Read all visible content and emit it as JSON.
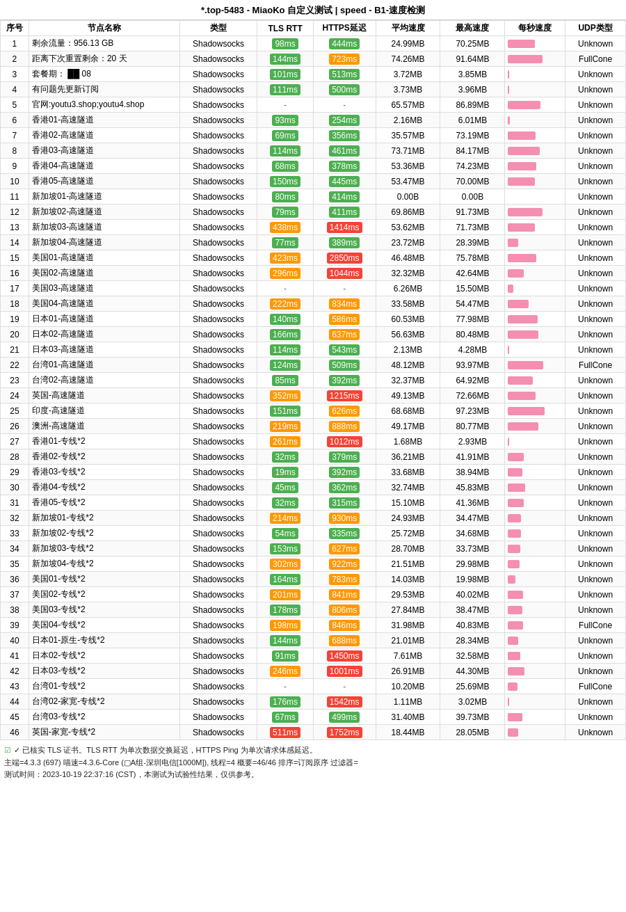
{
  "title": "*.top-5483 - MiaoKo 自定义测试 | speed - B1-速度检测",
  "columns": [
    "序号",
    "节点名称",
    "类型",
    "TLS RTT",
    "HTTPS延迟",
    "平均速度",
    "最高速度",
    "每秒速度",
    "UDP类型"
  ],
  "rows": [
    {
      "no": 1,
      "name": "剩余流量：956.13 GB",
      "type": "Shadowsocks",
      "tls": "98ms",
      "tlsClass": "tls-green",
      "https": "444ms",
      "httpsClass": "https-green",
      "avg": "24.99MB",
      "max": "70.25MB",
      "barW": 70,
      "udp": "Unknown"
    },
    {
      "no": 2,
      "name": "距离下次重置剩余：20 天",
      "type": "Shadowsocks",
      "tls": "144ms",
      "tlsClass": "tls-green",
      "https": "723ms",
      "httpsClass": "https-orange",
      "avg": "74.26MB",
      "max": "91.64MB",
      "barW": 90,
      "udp": "FullCone"
    },
    {
      "no": 3,
      "name": "套餐期：  ██  08",
      "type": "Shadowsocks",
      "tls": "101ms",
      "tlsClass": "tls-green",
      "https": "513ms",
      "httpsClass": "https-green",
      "avg": "3.72MB",
      "max": "3.85MB",
      "barW": 4,
      "udp": "Unknown"
    },
    {
      "no": 4,
      "name": "有问题先更新订阅",
      "type": "Shadowsocks",
      "tls": "111ms",
      "tlsClass": "tls-green",
      "https": "500ms",
      "httpsClass": "https-green",
      "avg": "3.73MB",
      "max": "3.96MB",
      "barW": 4,
      "udp": "Unknown"
    },
    {
      "no": 5,
      "name": "官网:youtu3.shop;youtu4.shop",
      "type": "Shadowsocks",
      "tls": "-",
      "tlsClass": "tls-dash",
      "https": "-",
      "httpsClass": "https-dash",
      "avg": "65.57MB",
      "max": "86.89MB",
      "barW": 86,
      "udp": "Unknown"
    },
    {
      "no": 6,
      "name": "香港01-高速隧道",
      "type": "Shadowsocks",
      "tls": "93ms",
      "tlsClass": "tls-green",
      "https": "254ms",
      "httpsClass": "https-green",
      "avg": "2.16MB",
      "max": "6.01MB",
      "barW": 6,
      "udp": "Unknown"
    },
    {
      "no": 7,
      "name": "香港02-高速隧道",
      "type": "Shadowsocks",
      "tls": "69ms",
      "tlsClass": "tls-green",
      "https": "356ms",
      "httpsClass": "https-green",
      "avg": "35.57MB",
      "max": "73.19MB",
      "barW": 73,
      "udp": "Unknown"
    },
    {
      "no": 8,
      "name": "香港03-高速隧道",
      "type": "Shadowsocks",
      "tls": "114ms",
      "tlsClass": "tls-green",
      "https": "461ms",
      "httpsClass": "https-green",
      "avg": "73.71MB",
      "max": "84.17MB",
      "barW": 84,
      "udp": "Unknown"
    },
    {
      "no": 9,
      "name": "香港04-高速隧道",
      "type": "Shadowsocks",
      "tls": "68ms",
      "tlsClass": "tls-green",
      "https": "378ms",
      "httpsClass": "https-green",
      "avg": "53.36MB",
      "max": "74.23MB",
      "barW": 74,
      "udp": "Unknown"
    },
    {
      "no": 10,
      "name": "香港05-高速隧道",
      "type": "Shadowsocks",
      "tls": "150ms",
      "tlsClass": "tls-green",
      "https": "445ms",
      "httpsClass": "https-green",
      "avg": "53.47MB",
      "max": "70.00MB",
      "barW": 70,
      "udp": "Unknown"
    },
    {
      "no": 11,
      "name": "新加坡01-高速隧道",
      "type": "Shadowsocks",
      "tls": "80ms",
      "tlsClass": "tls-green",
      "https": "414ms",
      "httpsClass": "https-green",
      "avg": "0.00B",
      "max": "0.00B",
      "barW": 0,
      "udp": "Unknown"
    },
    {
      "no": 12,
      "name": "新加坡02-高速隧道",
      "type": "Shadowsocks",
      "tls": "79ms",
      "tlsClass": "tls-green",
      "https": "411ms",
      "httpsClass": "https-green",
      "avg": "69.86MB",
      "max": "91.73MB",
      "barW": 91,
      "udp": "Unknown"
    },
    {
      "no": 13,
      "name": "新加坡03-高速隧道",
      "type": "Shadowsocks",
      "tls": "438ms",
      "tlsClass": "tls-orange",
      "https": "1414ms",
      "httpsClass": "https-red",
      "avg": "53.62MB",
      "max": "71.73MB",
      "barW": 71,
      "udp": "Unknown"
    },
    {
      "no": 14,
      "name": "新加坡04-高速隧道",
      "type": "Shadowsocks",
      "tls": "77ms",
      "tlsClass": "tls-green",
      "https": "389ms",
      "httpsClass": "https-green",
      "avg": "23.72MB",
      "max": "28.39MB",
      "barW": 28,
      "udp": "Unknown"
    },
    {
      "no": 15,
      "name": "美国01-高速隧道",
      "type": "Shadowsocks",
      "tls": "423ms",
      "tlsClass": "tls-orange",
      "https": "2850ms",
      "httpsClass": "https-red",
      "avg": "46.48MB",
      "max": "75.78MB",
      "barW": 75,
      "udp": "Unknown"
    },
    {
      "no": 16,
      "name": "美国02-高速隧道",
      "type": "Shadowsocks",
      "tls": "296ms",
      "tlsClass": "tls-orange",
      "https": "1044ms",
      "httpsClass": "https-red",
      "avg": "32.32MB",
      "max": "42.64MB",
      "barW": 42,
      "udp": "Unknown"
    },
    {
      "no": 17,
      "name": "美国03-高速隧道",
      "type": "Shadowsocks",
      "tls": "-",
      "tlsClass": "tls-dash",
      "https": "-",
      "httpsClass": "https-dash",
      "avg": "6.26MB",
      "max": "15.50MB",
      "barW": 15,
      "udp": "Unknown"
    },
    {
      "no": 18,
      "name": "美国04-高速隧道",
      "type": "Shadowsocks",
      "tls": "222ms",
      "tlsClass": "tls-orange",
      "https": "834ms",
      "httpsClass": "https-orange",
      "avg": "33.58MB",
      "max": "54.47MB",
      "barW": 54,
      "udp": "Unknown"
    },
    {
      "no": 19,
      "name": "日本01-高速隧道",
      "type": "Shadowsocks",
      "tls": "140ms",
      "tlsClass": "tls-green",
      "https": "586ms",
      "httpsClass": "https-orange",
      "avg": "60.53MB",
      "max": "77.98MB",
      "barW": 78,
      "udp": "Unknown"
    },
    {
      "no": 20,
      "name": "日本02-高速隧道",
      "type": "Shadowsocks",
      "tls": "166ms",
      "tlsClass": "tls-green",
      "https": "637ms",
      "httpsClass": "https-orange",
      "avg": "56.63MB",
      "max": "80.48MB",
      "barW": 80,
      "udp": "Unknown"
    },
    {
      "no": 21,
      "name": "日本03-高速隧道",
      "type": "Shadowsocks",
      "tls": "114ms",
      "tlsClass": "tls-green",
      "https": "543ms",
      "httpsClass": "https-green",
      "avg": "2.13MB",
      "max": "4.28MB",
      "barW": 4,
      "udp": "Unknown"
    },
    {
      "no": 22,
      "name": "台湾01-高速隧道",
      "type": "Shadowsocks",
      "tls": "124ms",
      "tlsClass": "tls-green",
      "https": "509ms",
      "httpsClass": "https-green",
      "avg": "48.12MB",
      "max": "93.97MB",
      "barW": 93,
      "udp": "FullCone"
    },
    {
      "no": 23,
      "name": "台湾02-高速隧道",
      "type": "Shadowsocks",
      "tls": "85ms",
      "tlsClass": "tls-green",
      "https": "392ms",
      "httpsClass": "https-green",
      "avg": "32.37MB",
      "max": "64.92MB",
      "barW": 65,
      "udp": "Unknown"
    },
    {
      "no": 24,
      "name": "英国-高速隧道",
      "type": "Shadowsocks",
      "tls": "352ms",
      "tlsClass": "tls-orange",
      "https": "1215ms",
      "httpsClass": "https-red",
      "avg": "49.13MB",
      "max": "72.66MB",
      "barW": 72,
      "udp": "Unknown"
    },
    {
      "no": 25,
      "name": "印度-高速隧道",
      "type": "Shadowsocks",
      "tls": "151ms",
      "tlsClass": "tls-green",
      "https": "626ms",
      "httpsClass": "https-orange",
      "avg": "68.68MB",
      "max": "97.23MB",
      "barW": 97,
      "udp": "Unknown"
    },
    {
      "no": 26,
      "name": "澳洲-高速隧道",
      "type": "Shadowsocks",
      "tls": "219ms",
      "tlsClass": "tls-orange",
      "https": "888ms",
      "httpsClass": "https-orange",
      "avg": "49.17MB",
      "max": "80.77MB",
      "barW": 80,
      "udp": "Unknown"
    },
    {
      "no": 27,
      "name": "香港01-专线*2",
      "type": "Shadowsocks",
      "tls": "261ms",
      "tlsClass": "tls-orange",
      "https": "1012ms",
      "httpsClass": "https-red",
      "avg": "1.68MB",
      "max": "2.93MB",
      "barW": 3,
      "udp": "Unknown"
    },
    {
      "no": 28,
      "name": "香港02-专线*2",
      "type": "Shadowsocks",
      "tls": "32ms",
      "tlsClass": "tls-green",
      "https": "379ms",
      "httpsClass": "https-green",
      "avg": "36.21MB",
      "max": "41.91MB",
      "barW": 42,
      "udp": "Unknown"
    },
    {
      "no": 29,
      "name": "香港03-专线*2",
      "type": "Shadowsocks",
      "tls": "19ms",
      "tlsClass": "tls-green",
      "https": "392ms",
      "httpsClass": "https-green",
      "avg": "33.68MB",
      "max": "38.94MB",
      "barW": 39,
      "udp": "Unknown"
    },
    {
      "no": 30,
      "name": "香港04-专线*2",
      "type": "Shadowsocks",
      "tls": "45ms",
      "tlsClass": "tls-green",
      "https": "362ms",
      "httpsClass": "https-green",
      "avg": "32.74MB",
      "max": "45.83MB",
      "barW": 45,
      "udp": "Unknown"
    },
    {
      "no": 31,
      "name": "香港05-专线*2",
      "type": "Shadowsocks",
      "tls": "32ms",
      "tlsClass": "tls-green",
      "https": "315ms",
      "httpsClass": "https-green",
      "avg": "15.10MB",
      "max": "41.36MB",
      "barW": 41,
      "udp": "Unknown"
    },
    {
      "no": 32,
      "name": "新加坡01-专线*2",
      "type": "Shadowsocks",
      "tls": "214ms",
      "tlsClass": "tls-orange",
      "https": "930ms",
      "httpsClass": "https-orange",
      "avg": "24.93MB",
      "max": "34.47MB",
      "barW": 34,
      "udp": "Unknown"
    },
    {
      "no": 33,
      "name": "新加坡02-专线*2",
      "type": "Shadowsocks",
      "tls": "54ms",
      "tlsClass": "tls-green",
      "https": "335ms",
      "httpsClass": "https-green",
      "avg": "25.72MB",
      "max": "34.68MB",
      "barW": 34,
      "udp": "Unknown"
    },
    {
      "no": 34,
      "name": "新加坡03-专线*2",
      "type": "Shadowsocks",
      "tls": "153ms",
      "tlsClass": "tls-green",
      "https": "627ms",
      "httpsClass": "https-orange",
      "avg": "28.70MB",
      "max": "33.73MB",
      "barW": 33,
      "udp": "Unknown"
    },
    {
      "no": 35,
      "name": "新加坡04-专线*2",
      "type": "Shadowsocks",
      "tls": "302ms",
      "tlsClass": "tls-orange",
      "https": "922ms",
      "httpsClass": "https-orange",
      "avg": "21.51MB",
      "max": "29.98MB",
      "barW": 30,
      "udp": "Unknown"
    },
    {
      "no": 36,
      "name": "美国01-专线*2",
      "type": "Shadowsocks",
      "tls": "164ms",
      "tlsClass": "tls-green",
      "https": "783ms",
      "httpsClass": "https-orange",
      "avg": "14.03MB",
      "max": "19.98MB",
      "barW": 20,
      "udp": "Unknown"
    },
    {
      "no": 37,
      "name": "美国02-专线*2",
      "type": "Shadowsocks",
      "tls": "201ms",
      "tlsClass": "tls-orange",
      "https": "841ms",
      "httpsClass": "https-orange",
      "avg": "29.53MB",
      "max": "40.02MB",
      "barW": 40,
      "udp": "Unknown"
    },
    {
      "no": 38,
      "name": "美国03-专线*2",
      "type": "Shadowsocks",
      "tls": "178ms",
      "tlsClass": "tls-green",
      "https": "806ms",
      "httpsClass": "https-orange",
      "avg": "27.84MB",
      "max": "38.47MB",
      "barW": 38,
      "udp": "Unknown"
    },
    {
      "no": 39,
      "name": "美国04-专线*2",
      "type": "Shadowsocks",
      "tls": "198ms",
      "tlsClass": "tls-orange",
      "https": "846ms",
      "httpsClass": "https-orange",
      "avg": "31.98MB",
      "max": "40.83MB",
      "barW": 40,
      "udp": "FullCone"
    },
    {
      "no": 40,
      "name": "日本01-原生-专线*2",
      "type": "Shadowsocks",
      "tls": "144ms",
      "tlsClass": "tls-green",
      "https": "688ms",
      "httpsClass": "https-orange",
      "avg": "21.01MB",
      "max": "28.34MB",
      "barW": 28,
      "udp": "Unknown"
    },
    {
      "no": 41,
      "name": "日本02-专线*2",
      "type": "Shadowsocks",
      "tls": "91ms",
      "tlsClass": "tls-green",
      "https": "1450ms",
      "httpsClass": "https-red",
      "avg": "7.61MB",
      "max": "32.58MB",
      "barW": 32,
      "udp": "Unknown"
    },
    {
      "no": 42,
      "name": "日本03-专线*2",
      "type": "Shadowsocks",
      "tls": "246ms",
      "tlsClass": "tls-orange",
      "https": "1001ms",
      "httpsClass": "https-red",
      "avg": "26.91MB",
      "max": "44.30MB",
      "barW": 44,
      "udp": "Unknown"
    },
    {
      "no": 43,
      "name": "台湾01-专线*2",
      "type": "Shadowsocks",
      "tls": "-",
      "tlsClass": "tls-dash",
      "https": "-",
      "httpsClass": "https-dash",
      "avg": "10.20MB",
      "max": "25.69MB",
      "barW": 25,
      "udp": "FullCone"
    },
    {
      "no": 44,
      "name": "台湾02-家宽-专线*2",
      "type": "Shadowsocks",
      "tls": "176ms",
      "tlsClass": "tls-green",
      "https": "1542ms",
      "httpsClass": "https-red",
      "avg": "1.11MB",
      "max": "3.02MB",
      "barW": 3,
      "udp": "Unknown"
    },
    {
      "no": 45,
      "name": "台湾03-专线*2",
      "type": "Shadowsocks",
      "tls": "67ms",
      "tlsClass": "tls-green",
      "https": "499ms",
      "httpsClass": "https-green",
      "avg": "31.40MB",
      "max": "39.73MB",
      "barW": 39,
      "udp": "Unknown"
    },
    {
      "no": 46,
      "name": "英国-家宽-专线*2",
      "type": "Shadowsocks",
      "tls": "511ms",
      "tlsClass": "tls-red",
      "https": "1752ms",
      "httpsClass": "https-red",
      "avg": "18.44MB",
      "max": "28.05MB",
      "barW": 28,
      "udp": "Unknown"
    }
  ],
  "footer": {
    "checkbox_label": "✓ 已核实 TLS 证书。TLS RTT 为单次数据交换延迟，HTTPS Ping 为单次请求体感延迟。",
    "line2": "主端=4.3.3 (697) 喵速=4.3.6-Core (▢A组-深圳电信[1000M]), 线程=4 概要=46/46 排序=订阅原序 过滤器=",
    "line3": "测试时间：2023-10-19 22:37:16 (CST)，本测试为试验性结果，仅供参考。"
  }
}
